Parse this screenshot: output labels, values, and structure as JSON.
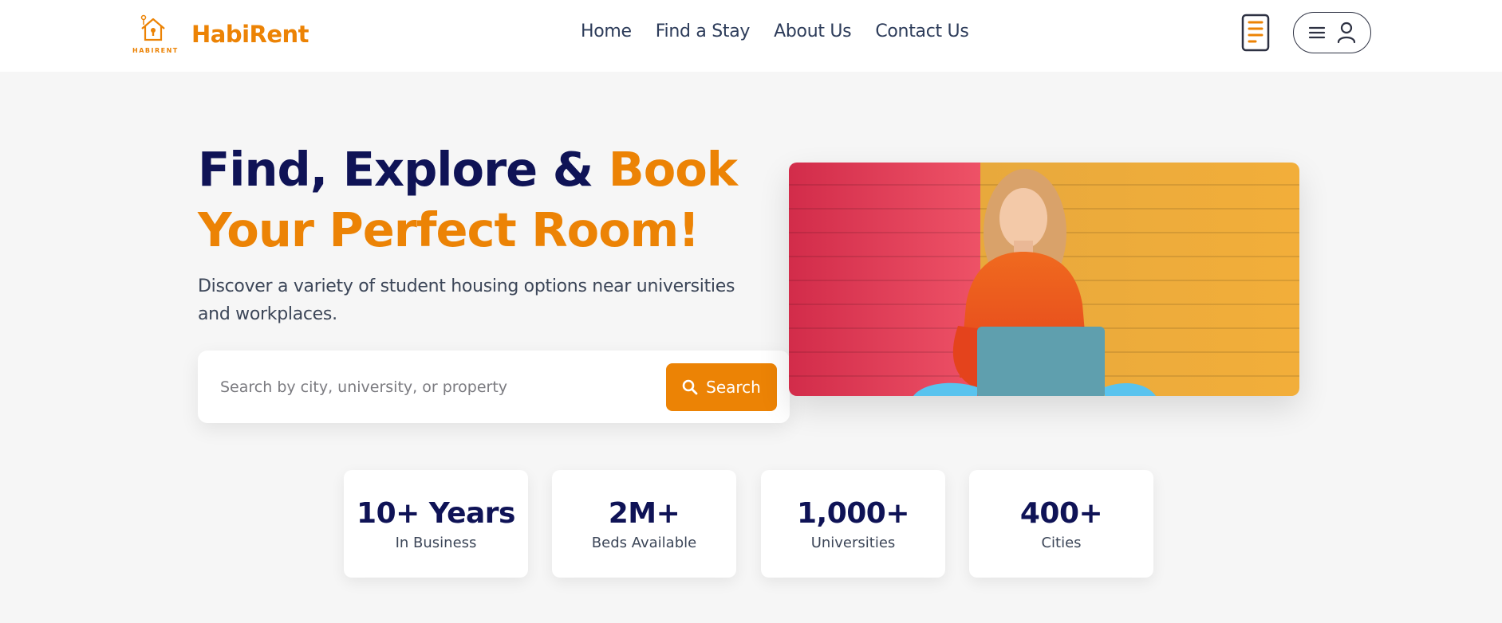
{
  "header": {
    "logo_small_text": "HABIRENT",
    "brand": "HabiRent",
    "nav": [
      {
        "label": "Home"
      },
      {
        "label": "Find a Stay"
      },
      {
        "label": "About Us"
      },
      {
        "label": "Contact Us"
      }
    ]
  },
  "hero": {
    "title_part1": "Find, Explore & ",
    "title_accent": "Book Your Perfect Room!",
    "subtitle": "Discover a variety of student housing options near universities and workplaces.",
    "search": {
      "placeholder": "Search by city, university, or property",
      "value": "",
      "button_label": "Search"
    }
  },
  "stats": [
    {
      "value": "10+ Years",
      "label": "In Business"
    },
    {
      "value": "2M+",
      "label": "Beds Available"
    },
    {
      "value": "1,000+",
      "label": "Universities"
    },
    {
      "value": "400+",
      "label": "Cities"
    }
  ],
  "colors": {
    "accent": "#ec8305",
    "navy": "#0f1356",
    "background": "#f6f6f6"
  },
  "icons": [
    "house-logo-icon",
    "phone-app-icon",
    "menu-icon",
    "user-icon",
    "search-icon"
  ]
}
